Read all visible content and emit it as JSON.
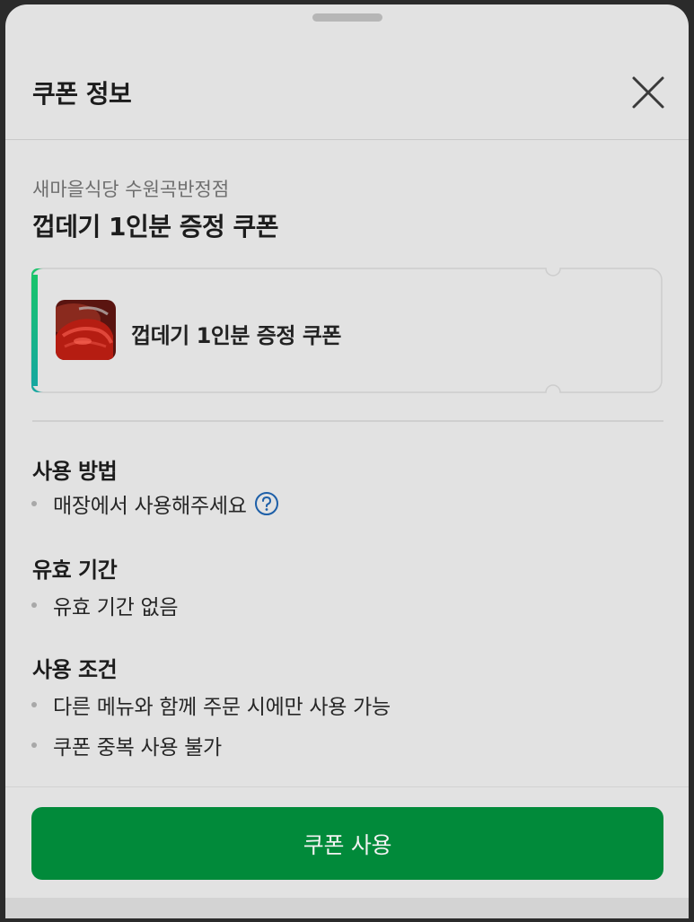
{
  "header": {
    "title": "쿠폰 정보",
    "close_icon": "close-icon"
  },
  "coupon": {
    "store_name": "새마을식당 수원곡반정점",
    "title": "껍데기 1인분 증정 쿠폰",
    "card_label": "껍데기 1인분 증정 쿠폰",
    "accent_color": "#16b57a",
    "thumbnail_icon": "grilled-pork-skin-photo"
  },
  "sections": {
    "usage_method": {
      "heading": "사용 방법",
      "items": [
        "매장에서 사용해주세요"
      ],
      "help_icon": "question-circle-icon"
    },
    "validity": {
      "heading": "유효 기간",
      "items": [
        "유효 기간 없음"
      ]
    },
    "conditions": {
      "heading": "사용 조건",
      "items": [
        "다른 메뉴와 함께 주문 시에만 사용 가능",
        "쿠폰 중복 사용 불가"
      ]
    }
  },
  "footer": {
    "use_button_label": "쿠폰 사용",
    "button_color": "#018a3a"
  }
}
